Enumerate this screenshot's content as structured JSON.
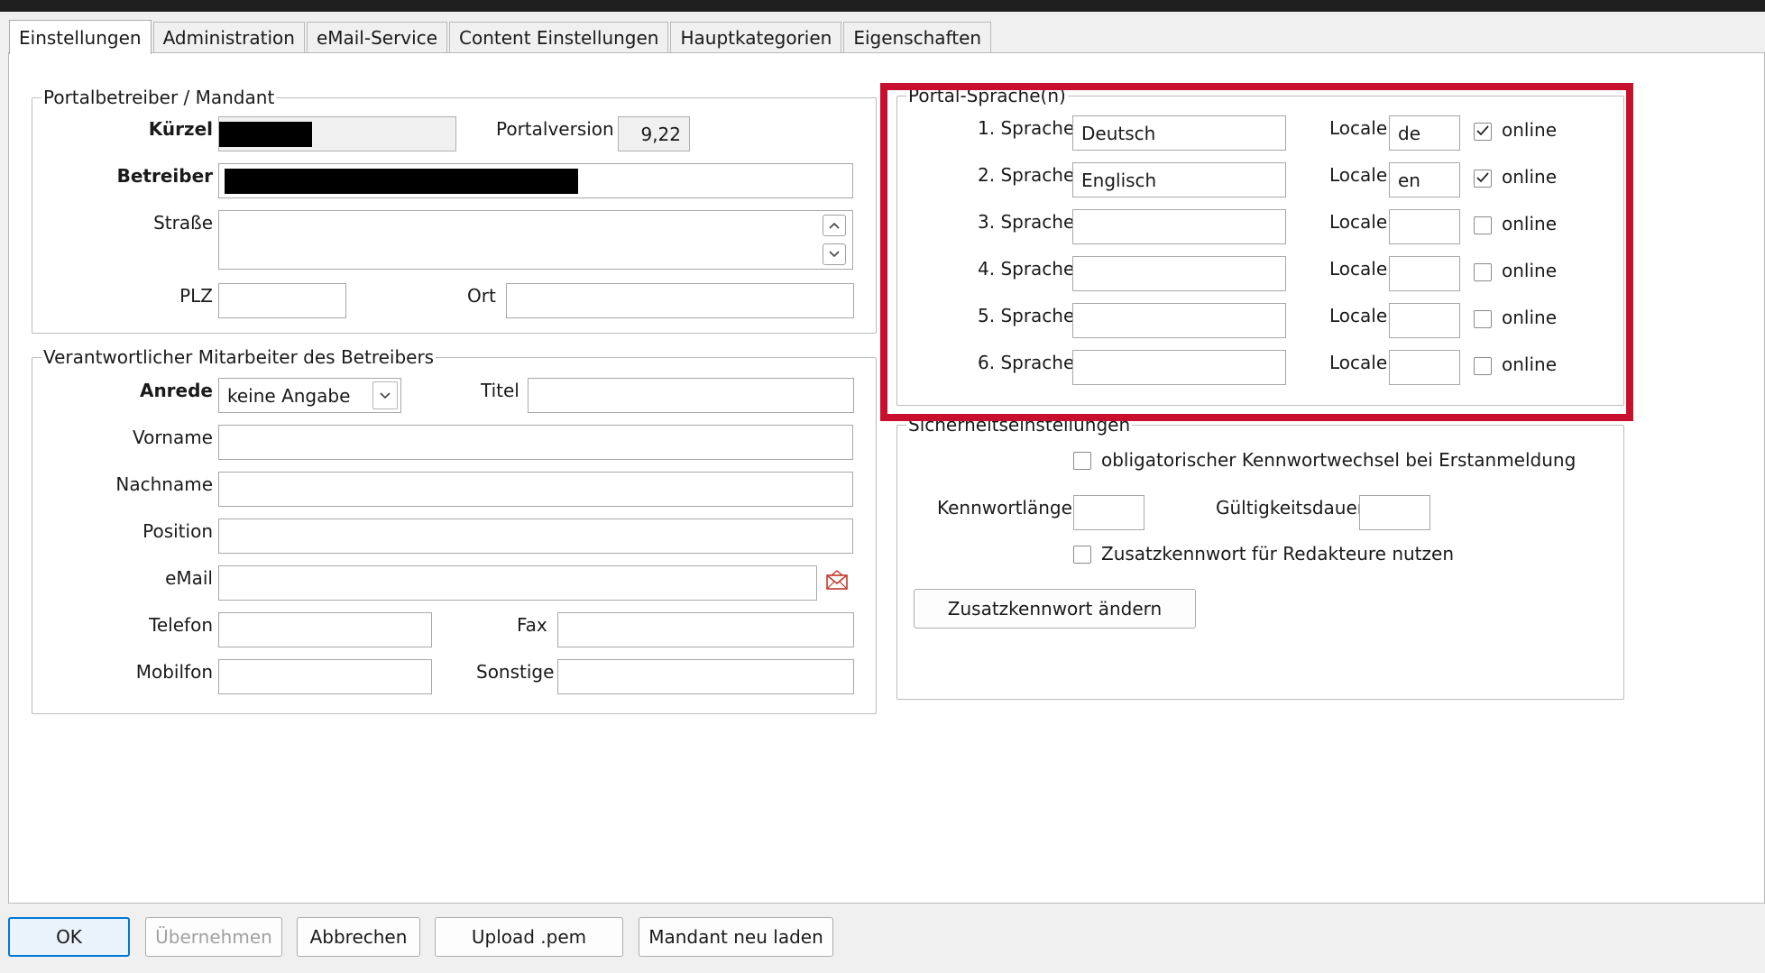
{
  "tabs": [
    "Einstellungen",
    "Administration",
    "eMail-Service",
    "Content Einstellungen",
    "Hauptkategorien",
    "Eigenschaften"
  ],
  "portalbetreiber": {
    "legend": "Portalbetreiber / Mandant",
    "kuerzel_label": "Kürzel",
    "portalversion_label": "Portalversion",
    "portalversion_value": "9,22",
    "betreiber_label": "Betreiber",
    "strasse_label": "Straße",
    "plz_label": "PLZ",
    "ort_label": "Ort"
  },
  "mitarbeiter": {
    "legend": "Verantwortlicher Mitarbeiter des Betreibers",
    "anrede_label": "Anrede",
    "anrede_value": "keine Angabe",
    "titel_label": "Titel",
    "vorname_label": "Vorname",
    "nachname_label": "Nachname",
    "position_label": "Position",
    "email_label": "eMail",
    "telefon_label": "Telefon",
    "fax_label": "Fax",
    "mobilfon_label": "Mobilfon",
    "sonstige_label": "Sonstige"
  },
  "sprachen": {
    "legend": "Portal-Sprache(n)",
    "locale_label": "Locale",
    "online_label": "online",
    "rows": [
      {
        "label": "1. Sprache",
        "value": "Deutsch",
        "locale": "de",
        "online": true
      },
      {
        "label": "2. Sprache",
        "value": "Englisch",
        "locale": "en",
        "online": true
      },
      {
        "label": "3. Sprache",
        "value": "",
        "locale": "",
        "online": false
      },
      {
        "label": "4. Sprache",
        "value": "",
        "locale": "",
        "online": false
      },
      {
        "label": "5. Sprache",
        "value": "",
        "locale": "",
        "online": false
      },
      {
        "label": "6. Sprache",
        "value": "",
        "locale": "",
        "online": false
      }
    ]
  },
  "sicherheit": {
    "legend": "Sicherheitseinstellungen",
    "kennwortwechsel_label": "obligatorischer Kennwortwechsel bei Erstanmeldung",
    "kennwortlaenge_label": "Kennwortlänge",
    "gueltigkeit_label": "Gültigkeitsdauer",
    "zusatzkennwort_label": "Zusatzkennwort für Redakteure nutzen",
    "zusatzkennwort_button": "Zusatzkennwort ändern"
  },
  "buttons": {
    "ok": "OK",
    "uebernehmen": "Übernehmen",
    "abbrechen": "Abbrechen",
    "upload": "Upload .pem",
    "mandant_neu_laden": "Mandant neu laden"
  },
  "colors": {
    "highlight": "#c8102e",
    "focus": "#0078d7"
  }
}
